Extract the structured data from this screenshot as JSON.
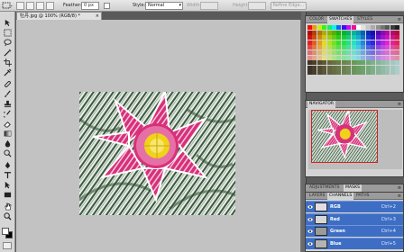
{
  "options_bar": {
    "feather_label": "Feather:",
    "feather_value": "0 px",
    "style_label": "Style:",
    "style_value": "Normal",
    "width_label": "Width:",
    "height_label": "Height:",
    "refine_edge_label": "Refine Edge..."
  },
  "document": {
    "tab_title": "牡丹.jpg @ 100% (RGB/8) *",
    "tab_close": "×"
  },
  "tools": [
    "move",
    "marquee",
    "lasso",
    "quick-select",
    "crop",
    "eyedropper",
    "healing",
    "brush",
    "clone-stamp",
    "history-brush",
    "eraser",
    "gradient",
    "blur",
    "dodge",
    "pen",
    "type",
    "path-select",
    "shape",
    "hand",
    "zoom"
  ],
  "swatches_panel": {
    "tabs": [
      "COLOR",
      "SWATCHES",
      "STYLES"
    ],
    "active_tab": "SWATCHES",
    "menu": "≡"
  },
  "navigator_panel": {
    "tabs": [
      "NAVIGATOR"
    ],
    "menu": "≡"
  },
  "adjust_panel": {
    "tabs": [
      "ADJUSTMENTS",
      "MASKS"
    ],
    "menu": "≡"
  },
  "channels_panel": {
    "tabs": [
      "LAYERS",
      "CHANNELS",
      "PATHS"
    ],
    "active_tab": "CHANNELS",
    "menu": "≡",
    "rows": [
      {
        "name": "RGB",
        "shortcut": "Ctrl+2",
        "tint": "#e6dde0"
      },
      {
        "name": "Red",
        "shortcut": "Ctrl+3",
        "tint": "#d7d7d7"
      },
      {
        "name": "Green",
        "shortcut": "Ctrl+4",
        "tint": "#9a9a9a"
      },
      {
        "name": "Blue",
        "shortcut": "Ctrl+5",
        "tint": "#b4b4b4"
      }
    ]
  },
  "colors": {
    "accent": "#3d6ec4",
    "doc_background": "#c2c2c2",
    "petal": "#d8307a",
    "center": "#f0d21a"
  }
}
